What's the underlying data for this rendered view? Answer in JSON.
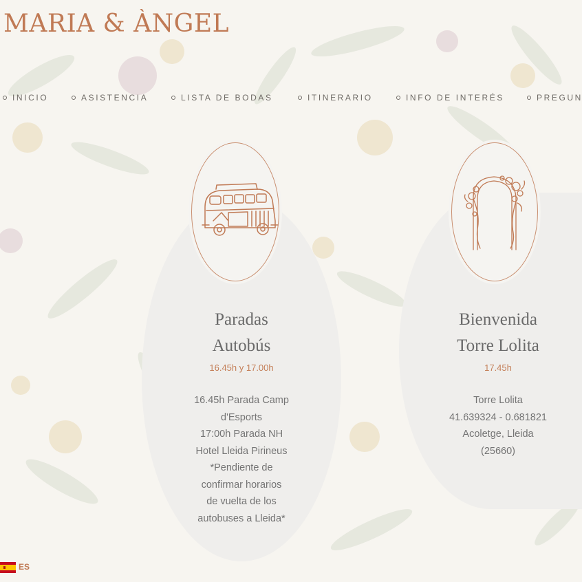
{
  "site": {
    "title": "MARIA & ÀNGEL"
  },
  "nav": {
    "items": [
      "INICIO",
      "ASISTENCIA",
      "LISTA DE BODAS",
      "ITINERARIO",
      "INFO DE INTERÉS",
      "PREGUNTAS"
    ]
  },
  "cards": [
    {
      "icon": "bus-icon",
      "title_line1": "Paradas",
      "title_line2": "Autobús",
      "time": "16.45h y 17.00h",
      "lines": [
        "16.45h Parada Camp",
        "d'Esports",
        "17:00h Parada NH",
        "Hotel Lleida Pirineus",
        "*Pendiente de",
        "confirmar horarios",
        "de vuelta de los",
        "autobuses a Lleida*"
      ]
    },
    {
      "icon": "floral-arch-icon",
      "title_line1": "Bienvenida",
      "title_line2": "Torre Lolita",
      "time": "17.45h",
      "lines": [
        "Torre Lolita",
        "41.639324 - 0.681821",
        "Acoletge, Lleida",
        "(25660)"
      ]
    }
  ],
  "language": {
    "code": "ES",
    "flag_icon": "spain-flag-icon"
  },
  "colors": {
    "accent": "#c07a55",
    "text": "#747474",
    "card": "#efeeec"
  }
}
